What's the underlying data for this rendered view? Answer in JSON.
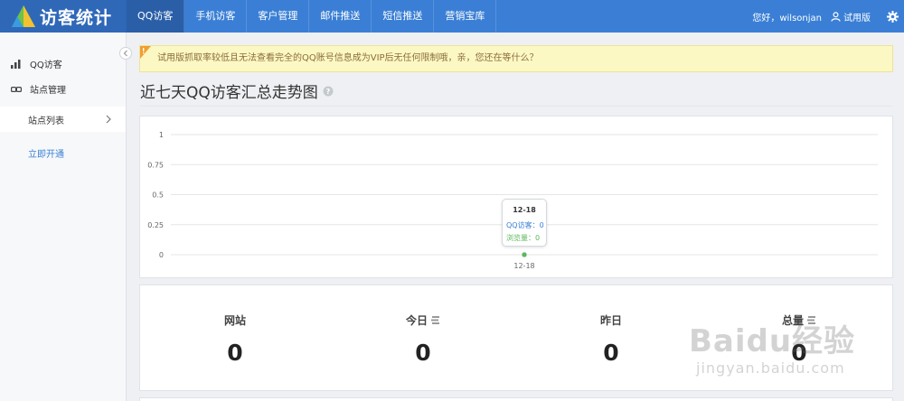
{
  "app": {
    "logo_text": "访客统计"
  },
  "nav": {
    "items": [
      {
        "label": "QQ访客",
        "active": true
      },
      {
        "label": "手机访客",
        "active": false
      },
      {
        "label": "客户管理",
        "active": false
      },
      {
        "label": "邮件推送",
        "active": false
      },
      {
        "label": "短信推送",
        "active": false
      },
      {
        "label": "营销宝库",
        "active": false
      }
    ]
  },
  "header": {
    "greeting": "您好，wilsonjan",
    "trial_label": "试用版"
  },
  "sidebar": {
    "items": [
      {
        "label": "QQ访客",
        "icon": "bar-chart-icon"
      },
      {
        "label": "站点管理",
        "icon": "link-icon"
      }
    ],
    "sub_item": "站点列表",
    "open_link": "立即开通"
  },
  "alert": {
    "text": "试用版抓取率较低且无法查看完全的QQ账号信息成为VIP后无任何限制哦，亲，您还在等什么？"
  },
  "page": {
    "title": "近七天QQ访客汇总走势图"
  },
  "chart_data": {
    "type": "line",
    "x": [
      "12-18"
    ],
    "series": [
      {
        "name": "QQ访客",
        "values": [
          0
        ],
        "color": "#3a7fd5"
      },
      {
        "name": "浏览量",
        "values": [
          0
        ],
        "color": "#5cb85c"
      }
    ],
    "ylim": [
      0,
      1
    ],
    "yticks": [
      "1",
      "0.75",
      "0.5",
      "0.25",
      "0"
    ],
    "grid": true,
    "tooltip": {
      "date": "12-18",
      "rows": [
        {
          "label": "QQ访客：",
          "value": "0",
          "color": "#3a7fd5"
        },
        {
          "label": "浏览量：",
          "value": "0",
          "color": "#5cb85c"
        }
      ]
    }
  },
  "stats": [
    {
      "label": "网站",
      "value": "0",
      "has_icon": false
    },
    {
      "label": "今日",
      "value": "0",
      "has_icon": true
    },
    {
      "label": "昨日",
      "value": "0",
      "has_icon": false
    },
    {
      "label": "总量",
      "value": "0",
      "has_icon": true
    }
  ],
  "watermark": {
    "top": "Baidu经验",
    "bottom": "jingyan.baidu.com"
  },
  "colors": {
    "primary": "#3a7fd5",
    "nav_dark": "#2a5fa8",
    "alert_bg": "#fcf8c4",
    "green": "#5cb85c"
  }
}
